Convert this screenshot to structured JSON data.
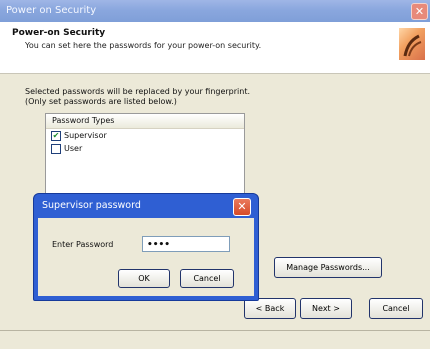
{
  "window": {
    "title": "Power on Security",
    "close_glyph": "✕"
  },
  "header": {
    "title": "Power-on Security",
    "subtitle": "You can set here the passwords for your power-on security."
  },
  "info": {
    "line1": "Selected passwords will be replaced by your fingerprint.",
    "line2": "(Only set passwords are listed below.)"
  },
  "password_list": {
    "column_header": "Password Types",
    "items": [
      {
        "label": "Supervisor",
        "checked": true
      },
      {
        "label": "User",
        "checked": false
      }
    ]
  },
  "manage_button": {
    "label": "Manage Passwords..."
  },
  "nav": {
    "back": "< Back",
    "next": "Next >",
    "cancel": "Cancel"
  },
  "dialog": {
    "title": "Supervisor password",
    "close_glyph": "✕",
    "field_label": "Enter Password",
    "field_value": "••••",
    "ok": "OK",
    "cancel": "Cancel"
  },
  "icons": {
    "check": "✔"
  },
  "colors": {
    "dialog_title_bar": "#2f5fd3",
    "inactive_title_bar": "#8aa7de",
    "close_button": "#d64a28"
  }
}
